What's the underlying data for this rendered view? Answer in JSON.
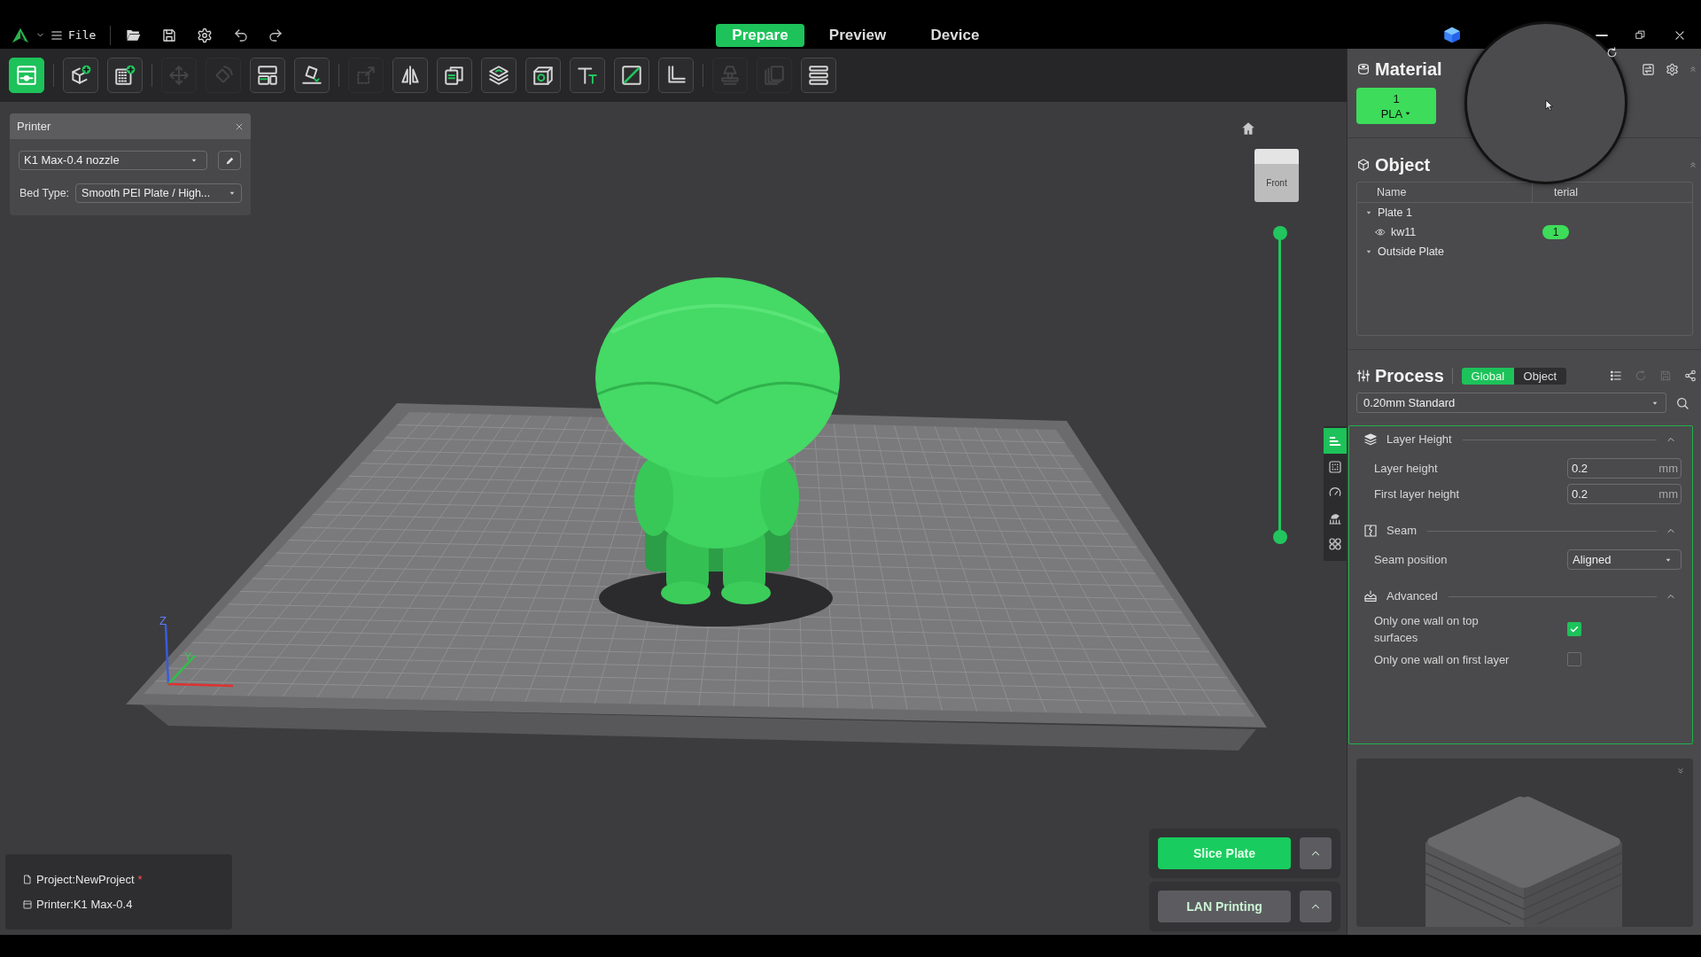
{
  "title_bar": {
    "menu_label": "File",
    "tabs": [
      {
        "label": "Prepare",
        "selected": true
      },
      {
        "label": "Preview",
        "selected": false
      },
      {
        "label": "Device",
        "selected": false
      }
    ]
  },
  "toolbar": {
    "groups": [
      [
        {
          "selected": true,
          "disabled": false
        }
      ],
      [
        {
          "selected": false,
          "disabled": false
        },
        {
          "selected": false,
          "disabled": false
        }
      ],
      [
        {
          "selected": false,
          "disabled": true
        },
        {
          "selected": false,
          "disabled": true
        },
        {
          "selected": false,
          "disabled": false
        },
        {
          "selected": false,
          "disabled": false
        }
      ],
      [
        {
          "selected": false,
          "disabled": true
        },
        {
          "selected": false,
          "disabled": false
        },
        {
          "selected": false,
          "disabled": false
        },
        {
          "selected": false,
          "disabled": false
        },
        {
          "selected": false,
          "disabled": false
        },
        {
          "selected": false,
          "disabled": false
        },
        {
          "selected": false,
          "disabled": false
        },
        {
          "selected": false,
          "disabled": false
        }
      ],
      [
        {
          "selected": false,
          "disabled": true
        },
        {
          "selected": false,
          "disabled": true
        },
        {
          "selected": false,
          "disabled": false
        }
      ]
    ]
  },
  "printer_panel": {
    "title": "Printer",
    "printer": "K1 Max-0.4 nozzle",
    "bed_type_label": "Bed Type:",
    "bed_type": "Smooth PEI Plate / High..."
  },
  "viewport": {
    "axis_labels": [
      "Z",
      "Y"
    ],
    "view_cube_label": "Front",
    "layer_slider": {
      "upper": {
        "level": 1
      },
      "lower": {
        "level": 0
      }
    }
  },
  "project_info": {
    "project": "Project:NewProject",
    "unsaved_mark": "*",
    "printer": "Printer:K1 Max-0.4"
  },
  "actions": [
    {
      "kind": "slice",
      "label": "Slice Plate"
    },
    {
      "kind": "print",
      "label": "LAN Printing"
    }
  ],
  "material": {
    "title": "Material",
    "filaments": [
      {
        "number": "1",
        "type": "PLA",
        "color": "#3ddc5a"
      }
    ]
  },
  "object": {
    "title": "Object",
    "columns": [
      "Name",
      "terial"
    ],
    "tree": [
      {
        "name": "Plate 1",
        "expanded": true,
        "children": [
          {
            "name": "kw11",
            "visible": true,
            "filament": "1",
            "color": "#3ddc5a"
          }
        ]
      },
      {
        "name": "Outside Plate",
        "expanded": true
      }
    ]
  },
  "process": {
    "title": "Process",
    "scope_tabs": [
      {
        "label": "Global",
        "selected": true
      },
      {
        "label": "Object",
        "selected": false
      }
    ],
    "tools": [
      {
        "disabled": false
      },
      {
        "disabled": true
      },
      {
        "disabled": true
      },
      {
        "disabled": false
      }
    ],
    "preset": "0.20mm Standard",
    "side_tabs": [
      {
        "selected": true
      },
      {
        "selected": false
      },
      {
        "selected": false
      },
      {
        "selected": false
      },
      {
        "selected": false
      }
    ],
    "sections": [
      {
        "title": "Layer Height",
        "expanded": true,
        "options": [
          {
            "kind": "number",
            "label": "Layer height",
            "value": "0.2",
            "unit": "mm"
          },
          {
            "kind": "number",
            "label": "First layer height",
            "value": "0.2",
            "unit": "mm"
          }
        ]
      },
      {
        "title": "Seam",
        "expanded": true,
        "options": [
          {
            "kind": "select",
            "label": "Seam position",
            "value": "Aligned"
          }
        ]
      },
      {
        "title": "Advanced",
        "expanded": true,
        "options": [
          {
            "kind": "checkbox",
            "label": "Only one wall on top surfaces",
            "checked": true
          },
          {
            "kind": "checkbox",
            "label": "Only one wall on first layer",
            "checked": false
          }
        ]
      }
    ]
  }
}
